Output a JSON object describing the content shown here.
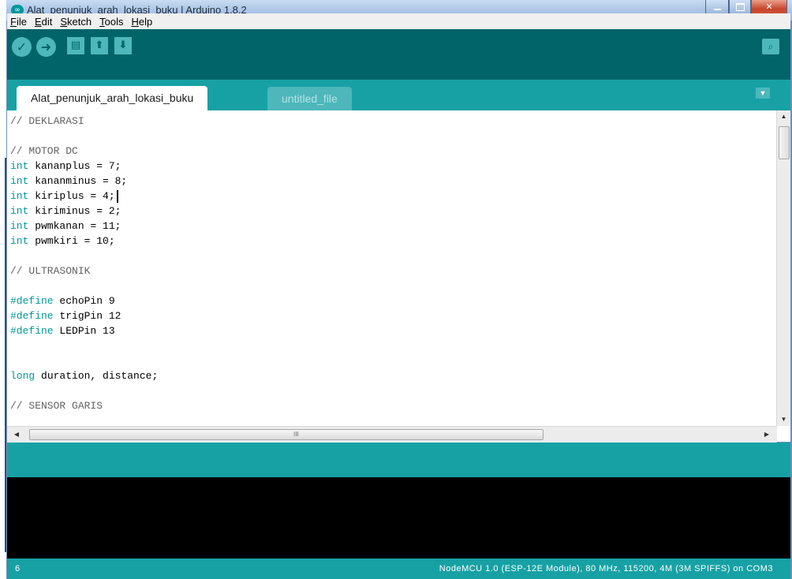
{
  "window": {
    "title": "Alat_penunjuk_arah_lokasi_buku | Arduino 1.8.2",
    "app_icon": "arduino-infinity-icon"
  },
  "menu": [
    {
      "label": "File",
      "accel": "F",
      "rest": "ile"
    },
    {
      "label": "Edit",
      "accel": "E",
      "rest": "dit"
    },
    {
      "label": "Sketch",
      "accel": "S",
      "rest": "ketch"
    },
    {
      "label": "Tools",
      "accel": "T",
      "rest": "ools"
    },
    {
      "label": "Help",
      "accel": "H",
      "rest": "elp"
    }
  ],
  "toolbar": {
    "buttons": [
      "verify-icon",
      "upload-icon",
      "new-icon",
      "open-icon",
      "save-icon"
    ],
    "right": "serial-monitor-icon"
  },
  "tabs": [
    {
      "label": "Alat_penunjuk_arah_lokasi_buku",
      "active": true
    },
    {
      "label": "untitled_file",
      "active": false
    }
  ],
  "editor": {
    "lines": [
      "// DEKLARASI",
      "",
      "// MOTOR DC",
      "int kananplus = 7;",
      "int kananminus = 8;",
      "int kiriplus = 4;",
      "int kiriminus = 2;",
      "int pwmkanan = 11;",
      "int pwmkiri = 10;",
      "",
      "// ULTRASONIK",
      "",
      "#define echoPin 9",
      "#define trigPin 12",
      "#define LEDPin 13",
      "",
      "",
      "long duration, distance;",
      "",
      "// SENSOR GARIS"
    ],
    "scroll_grip": "III"
  },
  "status": {
    "line_number": "6",
    "board_info": "NodeMCU 1.0 (ESP-12E Module), 80 MHz, 115200, 4M (3M SPIFFS) on COM3"
  },
  "colors": {
    "toolbar_bg": "#006468",
    "tabs_bg": "#17a1a5",
    "keyword": "#00979c",
    "console_bg": "#000000"
  }
}
